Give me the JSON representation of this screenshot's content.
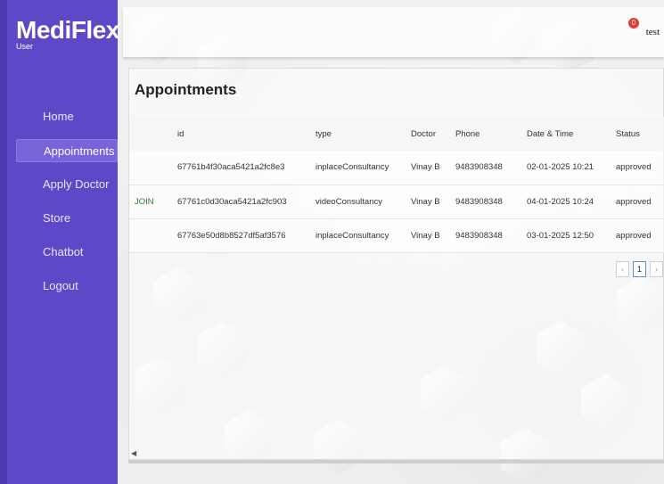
{
  "app": {
    "name": "MediFlex",
    "role": "User"
  },
  "sidebar": {
    "items": [
      {
        "label": "Home",
        "active": false
      },
      {
        "label": "Appointments",
        "active": true
      },
      {
        "label": "Apply Doctor",
        "active": false
      },
      {
        "label": "Store",
        "active": false
      },
      {
        "label": "Chatbot",
        "active": false
      },
      {
        "label": "Logout",
        "active": false
      }
    ]
  },
  "header": {
    "notification_count": "0",
    "username": "test"
  },
  "appointments": {
    "title": "Appointments",
    "columns": [
      "",
      "id",
      "type",
      "Doctor",
      "Phone",
      "Date & Time",
      "Status"
    ],
    "rows": [
      {
        "action": "",
        "id": "67761b4f30aca5421a2fc8e3",
        "type": "inplaceConsultancy",
        "doctor": "Vinay B",
        "phone": "9483908348",
        "datetime": "02-01-2025 10:21",
        "status": "approved"
      },
      {
        "action": "JOIN",
        "id": "67761c0d30aca5421a2fc903",
        "type": "videoConsultancy",
        "doctor": "Vinay B",
        "phone": "9483908348",
        "datetime": "04-01-2025 10:24",
        "status": "approved"
      },
      {
        "action": "",
        "id": "67763e50d8b8527df5af3576",
        "type": "inplaceConsultancy",
        "doctor": "Vinay B",
        "phone": "9483908348",
        "datetime": "03-01-2025 12:50",
        "status": "approved"
      }
    ],
    "pagination": {
      "prev": "‹",
      "current": "1",
      "next": "›"
    }
  },
  "colors": {
    "sidebar": "#5b49c8",
    "sidebar_active": "#7565d8",
    "join": "#2e7d32",
    "badge": "#e53935"
  }
}
